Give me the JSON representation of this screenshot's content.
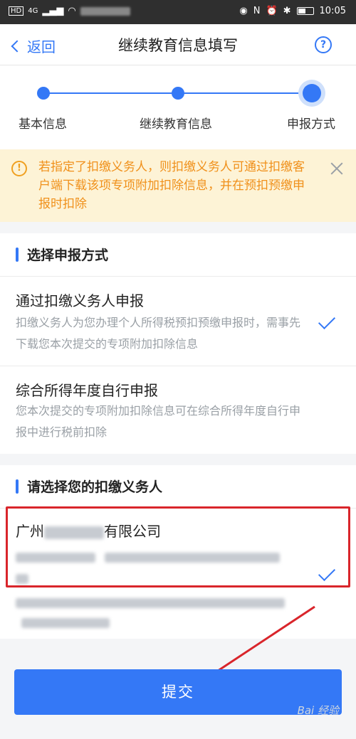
{
  "status_bar": {
    "network": "4G",
    "time": "10:05"
  },
  "nav": {
    "back_label": "返回",
    "title": "继续教育信息填写",
    "help_icon": "?"
  },
  "steps": {
    "items": [
      {
        "label": "基本信息"
      },
      {
        "label": "继续教育信息"
      },
      {
        "label": "申报方式"
      }
    ]
  },
  "notice": {
    "icon": "!",
    "text": "若指定了扣缴义务人，则扣缴义务人可通过扣缴客户端下载该项专项附加扣除信息，并在预扣预缴申报时扣除"
  },
  "method_section": {
    "title": "选择申报方式",
    "options": [
      {
        "title": "通过扣缴义务人申报",
        "desc": "扣缴义务人为您办理个人所得税预扣预缴申报时，需事先下载您本次提交的专项附加扣除信息",
        "selected": true
      },
      {
        "title": "综合所得年度自行申报",
        "desc": "您本次提交的专项附加扣除信息可在综合所得年度自行申报中进行税前扣除",
        "selected": false
      }
    ]
  },
  "agent_section": {
    "title": "请选择您的扣缴义务人",
    "company_prefix": "广州",
    "company_suffix": "有限公司",
    "selected": true
  },
  "submit_label": "提交",
  "watermark": "Bai 经验",
  "colors": {
    "accent": "#3478f6",
    "notice_bg": "#fdf3d6",
    "notice_text": "#f0901a",
    "annotation_red": "#d9252b"
  }
}
